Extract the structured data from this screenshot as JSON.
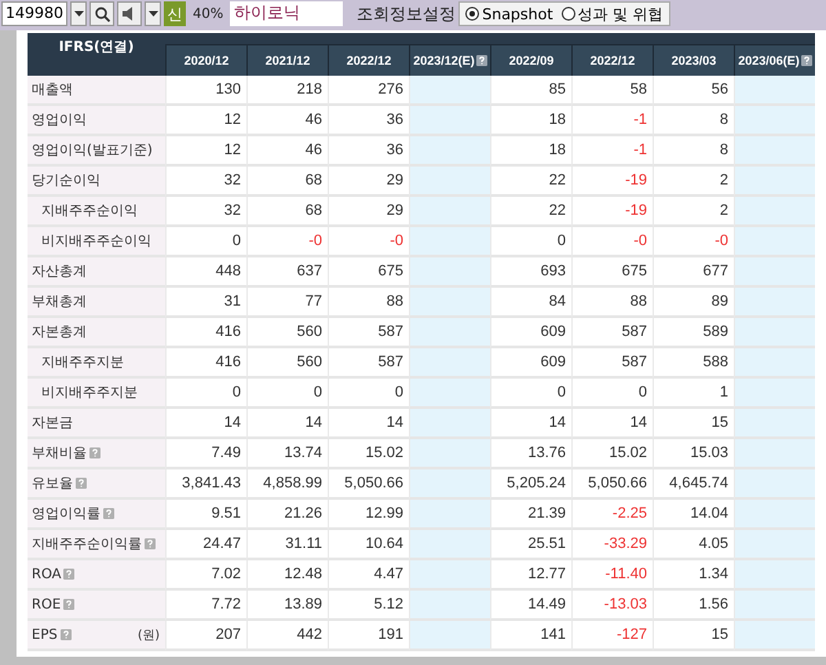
{
  "toolbar": {
    "code": "149980",
    "badge": "신",
    "ratio": "40%",
    "company": "하이로닉",
    "settings_label": "조회정보설정",
    "views": [
      {
        "label": "Snapshot",
        "selected": true
      },
      {
        "label": "성과 및 위협",
        "selected": false
      }
    ]
  },
  "table": {
    "corner": "IFRS(연결)",
    "columns": [
      {
        "label": "2020/12",
        "estimate": false
      },
      {
        "label": "2021/12",
        "estimate": false
      },
      {
        "label": "2022/12",
        "estimate": false
      },
      {
        "label": "2023/12(E)",
        "estimate": true
      },
      {
        "label": "2022/09",
        "estimate": false
      },
      {
        "label": "2022/12",
        "estimate": false
      },
      {
        "label": "2023/03",
        "estimate": false
      },
      {
        "label": "2023/06(E)",
        "estimate": true
      }
    ],
    "rows": [
      {
        "label": "매출액",
        "values": [
          "130",
          "218",
          "276",
          "85",
          "58",
          "56"
        ]
      },
      {
        "label": "영업이익",
        "values": [
          "12",
          "46",
          "36",
          "18",
          {
            "text": "-1",
            "negative": true
          },
          "8"
        ]
      },
      {
        "label": "영업이익(발표기준)",
        "values": [
          "12",
          "46",
          "36",
          "18",
          {
            "text": "-1",
            "negative": true
          },
          "8"
        ]
      },
      {
        "label": "당기순이익",
        "values": [
          "32",
          "68",
          "29",
          "22",
          {
            "text": "-19",
            "negative": true
          },
          "2"
        ],
        "children": [
          {
            "label": "지배주주순이익",
            "values": [
              "32",
              "68",
              "29",
              "22",
              {
                "text": "-19",
                "negative": true
              },
              "2"
            ]
          },
          {
            "label": "비지배주주순이익",
            "values": [
              "0",
              {
                "text": "-0",
                "negative": true
              },
              {
                "text": "-0",
                "negative": true
              },
              "0",
              {
                "text": "-0",
                "negative": true
              },
              {
                "text": "-0",
                "negative": true
              }
            ]
          }
        ]
      },
      {
        "label": "자산총계",
        "values": [
          "448",
          "637",
          "675",
          "693",
          "675",
          "677"
        ]
      },
      {
        "label": "부채총계",
        "values": [
          "31",
          "77",
          "88",
          "84",
          "88",
          "89"
        ]
      },
      {
        "label": "자본총계",
        "values": [
          "416",
          "560",
          "587",
          "609",
          "587",
          "589"
        ],
        "children": [
          {
            "label": "지배주주지분",
            "values": [
              "416",
              "560",
              "587",
              "609",
              "587",
              "588"
            ]
          },
          {
            "label": "비지배주주지분",
            "values": [
              "0",
              "0",
              "0",
              "0",
              "0",
              "1"
            ]
          }
        ]
      },
      {
        "label": "자본금",
        "values": [
          "14",
          "14",
          "14",
          "14",
          "14",
          "15"
        ]
      },
      {
        "label": "부채비율",
        "help": true,
        "values": [
          "7.49",
          "13.74",
          "15.02",
          "13.76",
          "15.02",
          "15.03"
        ]
      },
      {
        "label": "유보율",
        "help": true,
        "values": [
          "3,841.43",
          "4,858.99",
          "5,050.66",
          "5,205.24",
          "5,050.66",
          "4,645.74"
        ]
      },
      {
        "label": "영업이익률",
        "help": true,
        "values": [
          "9.51",
          "21.26",
          "12.99",
          "21.39",
          {
            "text": "-2.25",
            "negative": true
          },
          "14.04"
        ]
      },
      {
        "label": "지배주주순이익률",
        "help": true,
        "values": [
          "24.47",
          "31.11",
          "10.64",
          "25.51",
          {
            "text": "-33.29",
            "negative": true
          },
          "4.05"
        ]
      },
      {
        "label": "ROA",
        "help": true,
        "values": [
          "7.02",
          "12.48",
          "4.47",
          "12.77",
          {
            "text": "-11.40",
            "negative": true
          },
          "1.34"
        ]
      },
      {
        "label": "ROE",
        "help": true,
        "values": [
          "7.72",
          "13.89",
          "5.12",
          "14.49",
          {
            "text": "-13.03",
            "negative": true
          },
          "1.56"
        ]
      },
      {
        "label": "EPS",
        "help": true,
        "unit": "(원)",
        "values": [
          "207",
          "442",
          "191",
          "141",
          {
            "text": "-127",
            "negative": true
          },
          "15"
        ]
      }
    ]
  }
}
